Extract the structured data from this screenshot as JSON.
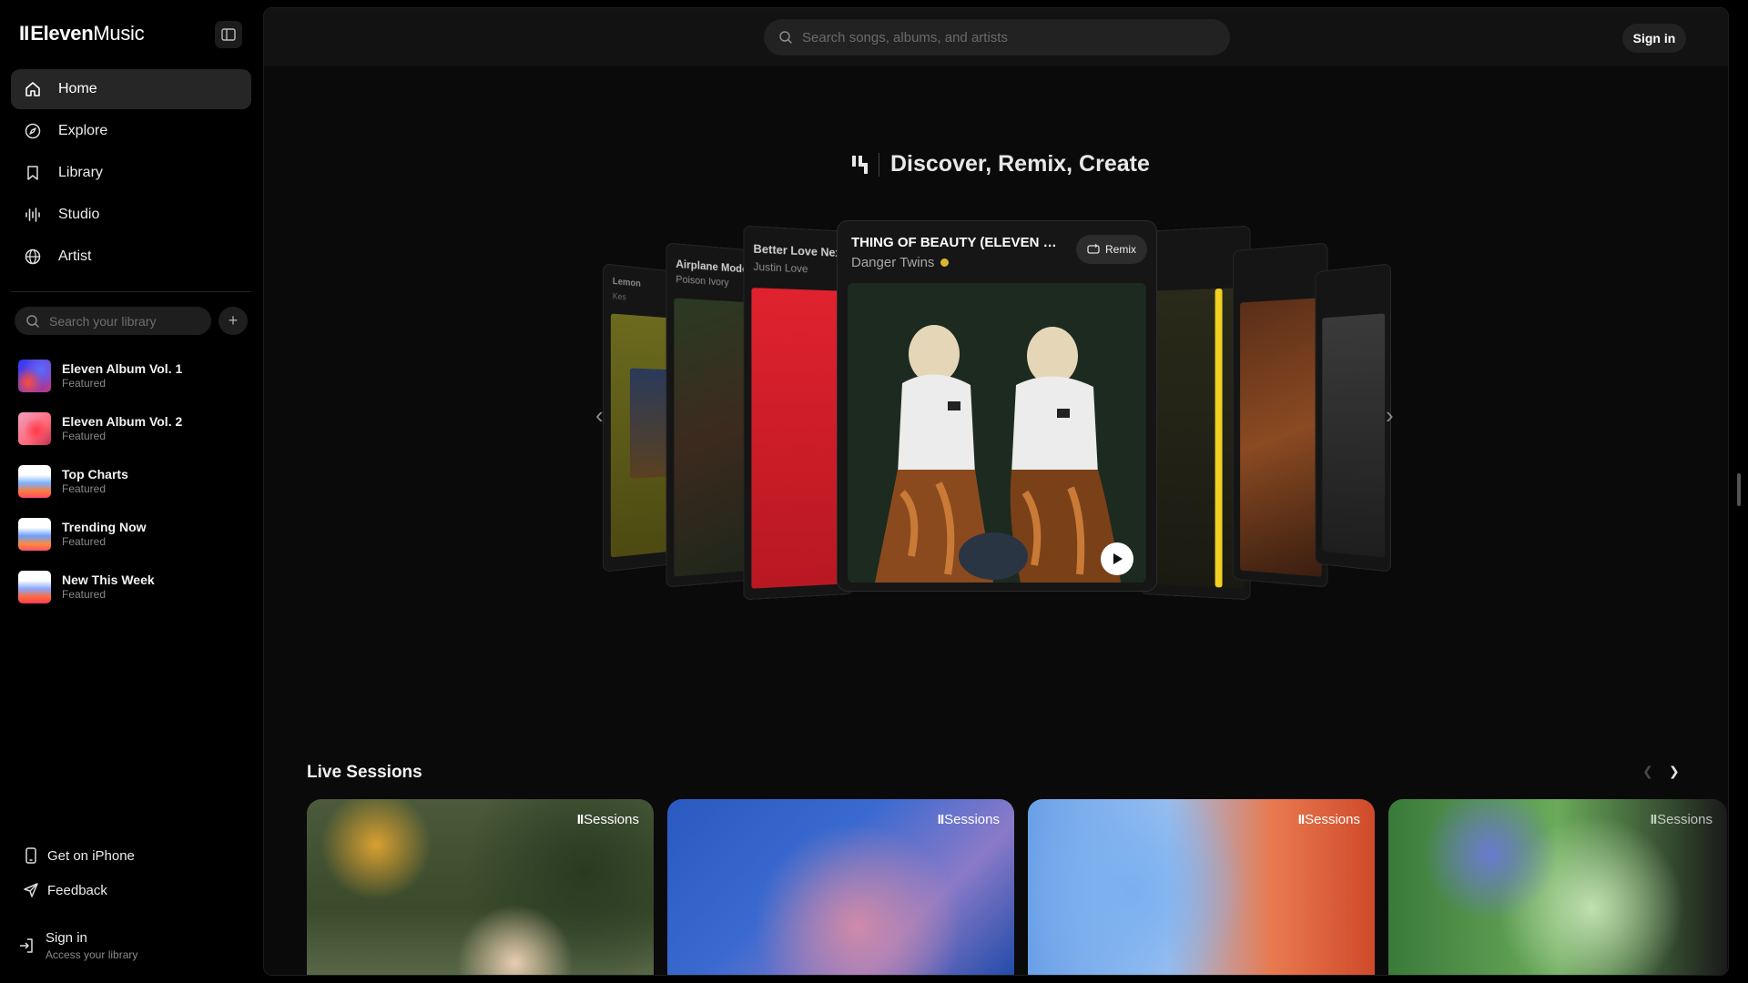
{
  "app": {
    "logo_bold": "Eleven",
    "logo_light": "Music"
  },
  "nav": [
    {
      "label": "Home",
      "icon": "home-icon",
      "active": true
    },
    {
      "label": "Explore",
      "icon": "compass-icon"
    },
    {
      "label": "Library",
      "icon": "bookmark-icon"
    },
    {
      "label": "Studio",
      "icon": "waveform-icon"
    },
    {
      "label": "Artist",
      "icon": "globe-icon"
    }
  ],
  "library": {
    "search_placeholder": "Search your library",
    "items": [
      {
        "title": "Eleven Album Vol. 1",
        "sub": "Featured"
      },
      {
        "title": "Eleven Album Vol. 2",
        "sub": "Featured"
      },
      {
        "title": "Top Charts",
        "sub": "Featured"
      },
      {
        "title": "Trending Now",
        "sub": "Featured"
      },
      {
        "title": "New This Week",
        "sub": "Featured"
      }
    ]
  },
  "sidebar_bottom": {
    "iphone": "Get on iPhone",
    "feedback": "Feedback",
    "signin": "Sign in",
    "signin_sub": "Access your library"
  },
  "topbar": {
    "search_placeholder": "Search songs, albums, and artists",
    "signin": "Sign in"
  },
  "hero": {
    "title": "Discover, Remix, Create"
  },
  "carousel": {
    "cards": [
      {
        "title": "Lemon",
        "artist": "Kes"
      },
      {
        "title": "Airplane Mode",
        "artist": "Poison Ivory"
      },
      {
        "title": "Better Love Next Ti",
        "artist": "Justin Love"
      }
    ],
    "featured": {
      "title": "THING OF BEAUTY (ELEVEN REMIX)",
      "artist": "Danger Twins",
      "remix_label": "Remix"
    }
  },
  "live_sessions": {
    "title": "Live Sessions",
    "brand": "Sessions"
  },
  "colors": {
    "background": "#000000",
    "panel": "#0a0a0a",
    "active_nav": "#262626",
    "verified_dot": "#d9b830"
  }
}
